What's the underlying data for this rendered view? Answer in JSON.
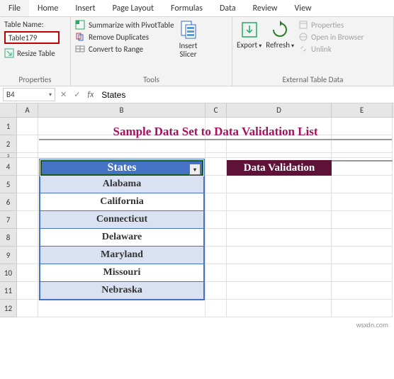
{
  "menu": [
    "File",
    "Home",
    "Insert",
    "Page Layout",
    "Formulas",
    "Data",
    "Review",
    "View"
  ],
  "ribbon": {
    "properties": {
      "table_name_label": "Table Name:",
      "table_name_value": "Table179",
      "resize": "Resize Table",
      "group": "Properties"
    },
    "tools": {
      "summarize": "Summarize with PivotTable",
      "remove_dup": "Remove Duplicates",
      "convert": "Convert to Range",
      "slicer1": "Insert",
      "slicer2": "Slicer",
      "group": "Tools"
    },
    "external": {
      "export": "Export",
      "refresh": "Refresh",
      "props": "Properties",
      "browser": "Open in Browser",
      "unlink": "Unlink",
      "group": "External Table Data"
    }
  },
  "namebox": "B4",
  "formula_value": "States",
  "colheads": [
    "A",
    "B",
    "C",
    "D",
    "E"
  ],
  "rowheads": [
    "1",
    "2",
    "3",
    "4",
    "5",
    "6",
    "7",
    "8",
    "9",
    "10",
    "11",
    "12"
  ],
  "sheet": {
    "title": "Sample Data Set to Data Validation List",
    "table_header": "States",
    "rows": [
      "Alabama",
      "California",
      "Connecticut",
      "Delaware",
      "Maryland",
      "Missouri",
      "Nebraska"
    ],
    "dv_label": "Data Validation"
  },
  "watermark": "wsxdn.com"
}
